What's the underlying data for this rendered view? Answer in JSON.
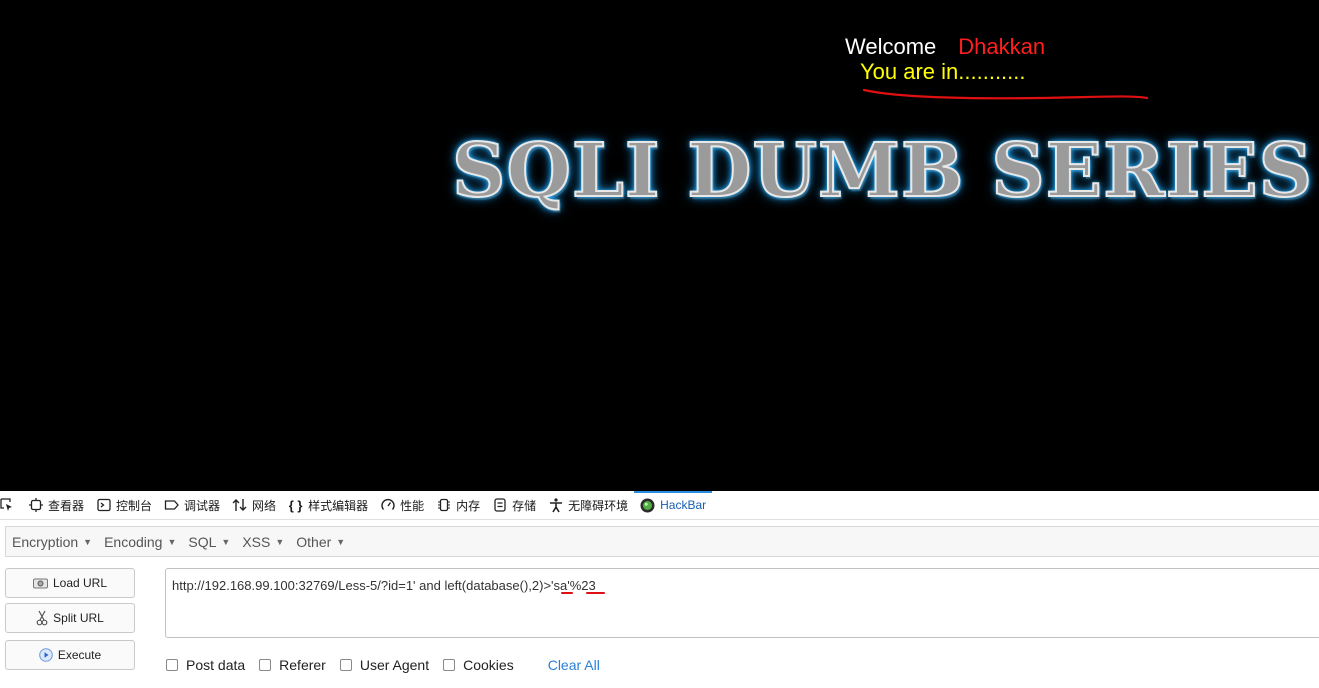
{
  "page": {
    "welcome_label": "Welcome",
    "user_name": "Dhakkan",
    "status_text": "You are in...........",
    "banner_text": "SQLI DUMB SERIES"
  },
  "devtools": {
    "tabs": [
      {
        "label": "查看器",
        "icon": "inspector-icon"
      },
      {
        "label": "控制台",
        "icon": "console-icon"
      },
      {
        "label": "调试器",
        "icon": "debugger-icon"
      },
      {
        "label": "网络",
        "icon": "network-icon"
      },
      {
        "label": "样式编辑器",
        "icon": "style-editor-icon"
      },
      {
        "label": "性能",
        "icon": "performance-icon"
      },
      {
        "label": "内存",
        "icon": "memory-icon"
      },
      {
        "label": "存储",
        "icon": "storage-icon"
      },
      {
        "label": "无障碍环境",
        "icon": "accessibility-icon"
      },
      {
        "label": "HackBar",
        "icon": "hackbar-logo-icon",
        "active": true
      }
    ]
  },
  "hackbar": {
    "menus": [
      "Encryption",
      "Encoding",
      "SQL",
      "XSS",
      "Other"
    ],
    "buttons": {
      "load_url": "Load URL",
      "split_url": "Split URL",
      "execute": "Execute"
    },
    "url_value": "http://192.168.99.100:32769/Less-5/?id=1' and left(database(),2)>'sa'%23",
    "options": [
      "Post data",
      "Referer",
      "User Agent",
      "Cookies"
    ],
    "clear_all": "Clear All"
  },
  "colors": {
    "welcome": "#ffffff",
    "user_name": "#ff1f1f",
    "status": "#ffff00",
    "banner_glow": "#27b3ff",
    "annotation": "#e01010",
    "link": "#2a7fd4"
  }
}
